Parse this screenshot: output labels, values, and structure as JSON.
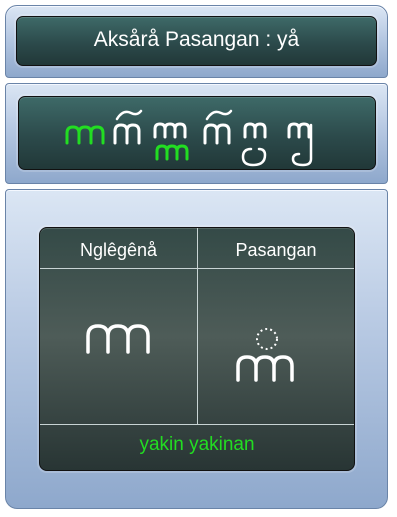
{
  "title": "Aksårå Pasangan : yå",
  "table": {
    "col1_header": "Nglêgênå",
    "col2_header": "Pasangan",
    "footer_word": "yakin yakinan"
  },
  "colors": {
    "highlight": "#22dd22",
    "text": "#ffffff"
  }
}
